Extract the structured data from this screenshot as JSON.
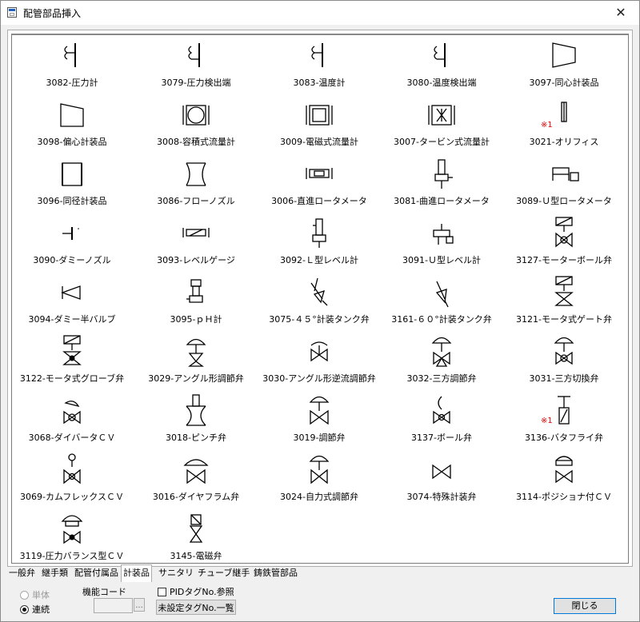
{
  "window": {
    "title": "配管部品挿入",
    "close_glyph": "✕"
  },
  "parts": [
    {
      "label": "3082-圧力計",
      "icon": "gauge-icon"
    },
    {
      "label": "3079-圧力検出端",
      "icon": "pressure-sensor-icon"
    },
    {
      "label": "3083-温度計",
      "icon": "thermometer-icon"
    },
    {
      "label": "3080-温度検出端",
      "icon": "temperature-sensor-icon"
    },
    {
      "label": "3097-同心計装品",
      "icon": "concentric-reducer-icon"
    },
    {
      "label": "3098-偏心計装品",
      "icon": "eccentric-reducer-icon"
    },
    {
      "label": "3008-容積式流量計",
      "icon": "positive-displacement-meter-icon"
    },
    {
      "label": "3009-電磁式流量計",
      "icon": "magnetic-flowmeter-icon"
    },
    {
      "label": "3007-タービン式流量計",
      "icon": "turbine-flowmeter-icon"
    },
    {
      "label": "3021-オリフィス",
      "icon": "orifice-icon",
      "note": "※1"
    },
    {
      "label": "3096-同径計装品",
      "icon": "same-size-instrument-icon"
    },
    {
      "label": "3086-フローノズル",
      "icon": "flow-nozzle-icon"
    },
    {
      "label": "3006-直進ロータメータ",
      "icon": "straight-rotameter-icon"
    },
    {
      "label": "3081-曲進ロータメータ",
      "icon": "angle-rotameter-icon"
    },
    {
      "label": "3089-Ｕ型ロータメータ",
      "icon": "u-rotameter-icon"
    },
    {
      "label": "3090-ダミーノズル",
      "icon": "dummy-nozzle-icon"
    },
    {
      "label": "3093-レベルゲージ",
      "icon": "level-gauge-icon"
    },
    {
      "label": "3092-Ｌ型レベル計",
      "icon": "l-level-meter-icon"
    },
    {
      "label": "3091-Ｕ型レベル計",
      "icon": "u-level-meter-icon"
    },
    {
      "label": "3127-モーターボール弁",
      "icon": "motor-ball-valve-icon"
    },
    {
      "label": "3094-ダミー半バルブ",
      "icon": "dummy-half-valve-icon"
    },
    {
      "label": "3095-ｐＨ計",
      "icon": "ph-meter-icon"
    },
    {
      "label": "3075-４５°計装タンク弁",
      "icon": "tank-valve-45-icon"
    },
    {
      "label": "3161-６０°計装タンク弁",
      "icon": "tank-valve-60-icon"
    },
    {
      "label": "3121-モータ式ゲート弁",
      "icon": "motor-gate-valve-icon"
    },
    {
      "label": "3122-モータ式グローブ弁",
      "icon": "motor-globe-valve-icon"
    },
    {
      "label": "3029-アングル形調節弁",
      "icon": "angle-control-valve-icon"
    },
    {
      "label": "3030-アングル形逆流調節弁",
      "icon": "angle-reverse-control-valve-icon"
    },
    {
      "label": "3032-三方調節弁",
      "icon": "three-way-control-valve-icon"
    },
    {
      "label": "3031-三方切換弁",
      "icon": "three-way-switch-valve-icon"
    },
    {
      "label": "3068-ダイバータＣＶ",
      "icon": "diverter-cv-icon"
    },
    {
      "label": "3018-ピンチ弁",
      "icon": "pinch-valve-icon"
    },
    {
      "label": "3019-調節弁",
      "icon": "control-valve-icon"
    },
    {
      "label": "3137-ボール弁",
      "icon": "ball-valve-icon"
    },
    {
      "label": "3136-バタフライ弁",
      "icon": "butterfly-valve-icon",
      "note": "※1"
    },
    {
      "label": "3069-カムフレックスＣＶ",
      "icon": "camflex-cv-icon"
    },
    {
      "label": "3016-ダイヤフラム弁",
      "icon": "diaphragm-valve-icon"
    },
    {
      "label": "3024-自力式調節弁",
      "icon": "self-operated-valve-icon"
    },
    {
      "label": "3074-特殊計装弁",
      "icon": "special-valve-icon"
    },
    {
      "label": "3114-ポジショナ付ＣＶ",
      "icon": "positioner-cv-icon"
    },
    {
      "label": "3119-圧力バランス型ＣＶ",
      "icon": "pressure-balance-cv-icon"
    },
    {
      "label": "3145-電磁弁",
      "icon": "solenoid-valve-icon"
    }
  ],
  "tabs": [
    {
      "label": "一般弁"
    },
    {
      "label": "継手類"
    },
    {
      "label": "配管付属品"
    },
    {
      "label": "計装品",
      "active": true
    },
    {
      "label": "サニタリ"
    },
    {
      "label": "チューブ継手"
    },
    {
      "label": "鋳鉄管部品"
    }
  ],
  "options": {
    "single_label": "単体",
    "continuous_label": "連続",
    "selected": "連続",
    "function_code_label": "機能コード",
    "function_code_value": "",
    "browse_label": "...",
    "pid_tag_label": "PIDタグNo.参照",
    "pid_tag_checked": false,
    "unset_tag_list_label": "未設定タグNo.一覧",
    "close_label": "閉じる"
  }
}
